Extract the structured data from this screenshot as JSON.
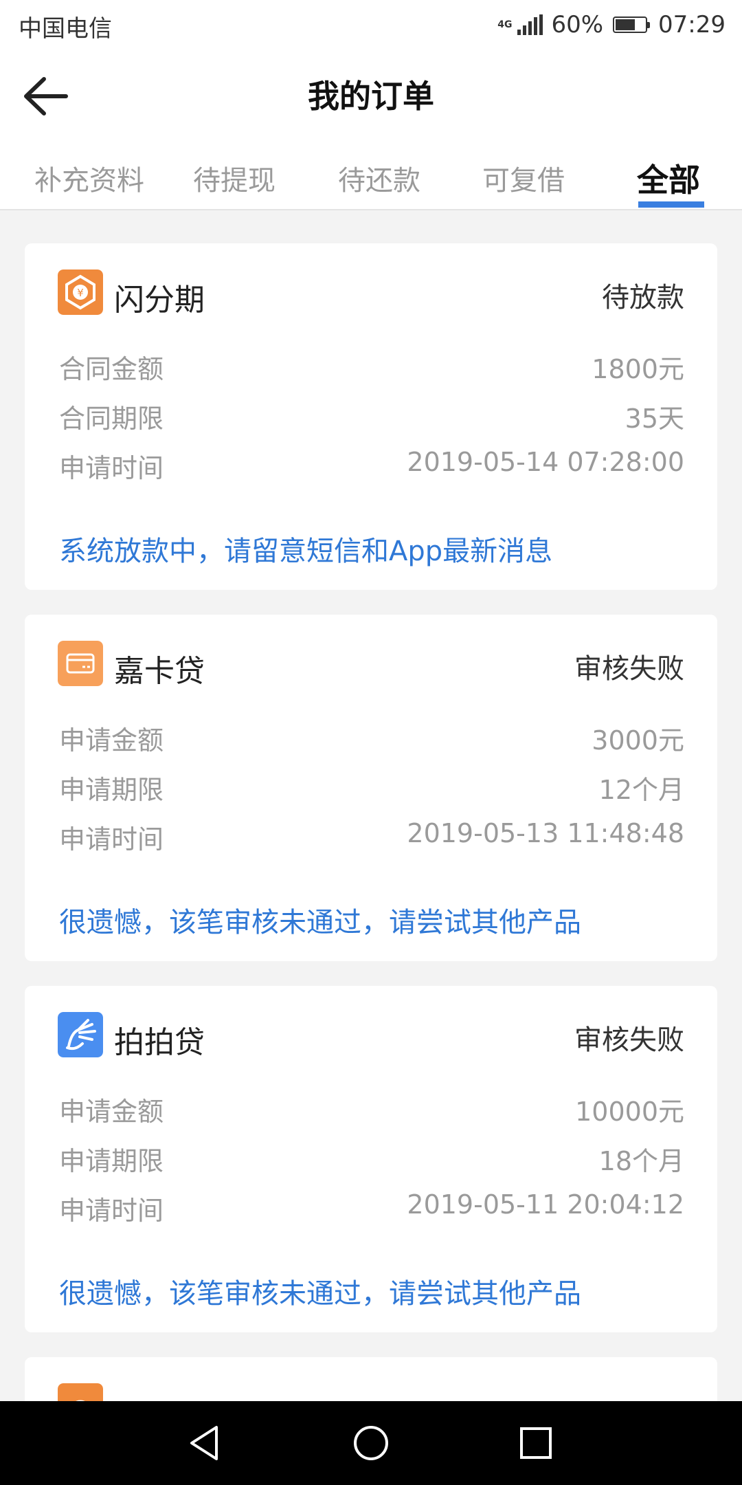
{
  "status_bar": {
    "carrier": "中国电信",
    "network": "4G",
    "battery": "60%",
    "time": "07:29"
  },
  "header": {
    "title": "我的订单"
  },
  "tabs": [
    {
      "label": "补充资料",
      "active": false
    },
    {
      "label": "待提现",
      "active": false
    },
    {
      "label": "待还款",
      "active": false
    },
    {
      "label": "可复借",
      "active": false
    },
    {
      "label": "全部",
      "active": true
    }
  ],
  "orders": [
    {
      "name": "闪分期",
      "status": "待放款",
      "logo": "flash-installment-logo-icon",
      "logo_color": "#f08a3c",
      "rows": [
        {
          "label": "合同金额",
          "value": "1800元"
        },
        {
          "label": "合同期限",
          "value": "35天"
        },
        {
          "label": "申请时间",
          "value": "2019-05-14 07:28:00"
        }
      ],
      "note": "系统放款中，请留意短信和App最新消息"
    },
    {
      "name": "嘉卡贷",
      "status": "审核失败",
      "logo": "card-loan-logo-icon",
      "logo_color": "#f7a05a",
      "rows": [
        {
          "label": "申请金额",
          "value": "3000元"
        },
        {
          "label": "申请期限",
          "value": "12个月"
        },
        {
          "label": "申请时间",
          "value": "2019-05-13 11:48:48"
        }
      ],
      "note": "很遗憾，该笔审核未通过，请尝试其他产品"
    },
    {
      "name": "拍拍贷",
      "status": "审核失败",
      "logo": "ppdai-logo-icon",
      "logo_color": "#4a8ef0",
      "rows": [
        {
          "label": "申请金额",
          "value": "10000元"
        },
        {
          "label": "申请期限",
          "value": "18个月"
        },
        {
          "label": "申请时间",
          "value": "2019-05-11 20:04:12"
        }
      ],
      "note": "很遗憾，该笔审核未通过，请尝试其他产品"
    }
  ],
  "colors": {
    "accent": "#3a7fe0",
    "note_blue": "#2f78d6",
    "background": "#f3f3f3"
  }
}
